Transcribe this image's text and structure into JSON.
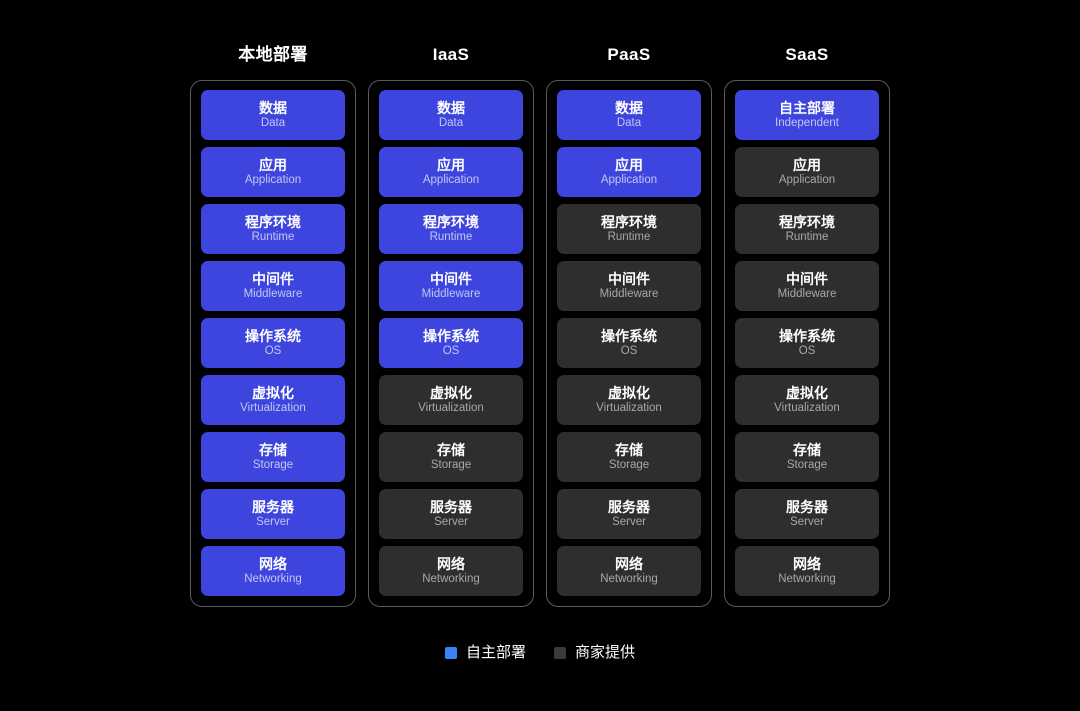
{
  "background_color": "#000000",
  "colors": {
    "self_deployed": "#3d45de",
    "vendor_provided": "#2e2e2e",
    "legend_self_deployed": "#3b82f6",
    "legend_vendor_provided": "#3a3a3a",
    "frame_border": "#5a5a5a",
    "title_text": "#ffffff",
    "en_on_blue": "#c3c7f2",
    "en_on_gray": "#a8a8a8"
  },
  "columns": [
    {
      "title": "本地部署",
      "layers": [
        {
          "zh": "数据",
          "en": "Data",
          "owner": "self"
        },
        {
          "zh": "应用",
          "en": "Application",
          "owner": "self"
        },
        {
          "zh": "程序环境",
          "en": "Runtime",
          "owner": "self"
        },
        {
          "zh": "中间件",
          "en": "Middleware",
          "owner": "self"
        },
        {
          "zh": "操作系统",
          "en": "OS",
          "owner": "self"
        },
        {
          "zh": "虚拟化",
          "en": "Virtualization",
          "owner": "self"
        },
        {
          "zh": "存储",
          "en": "Storage",
          "owner": "self"
        },
        {
          "zh": "服务器",
          "en": "Server",
          "owner": "self"
        },
        {
          "zh": "网络",
          "en": "Networking",
          "owner": "self"
        }
      ]
    },
    {
      "title": "IaaS",
      "layers": [
        {
          "zh": "数据",
          "en": "Data",
          "owner": "self"
        },
        {
          "zh": "应用",
          "en": "Application",
          "owner": "self"
        },
        {
          "zh": "程序环境",
          "en": "Runtime",
          "owner": "self"
        },
        {
          "zh": "中间件",
          "en": "Middleware",
          "owner": "self"
        },
        {
          "zh": "操作系统",
          "en": "OS",
          "owner": "self"
        },
        {
          "zh": "虚拟化",
          "en": "Virtualization",
          "owner": "vendor"
        },
        {
          "zh": "存储",
          "en": "Storage",
          "owner": "vendor"
        },
        {
          "zh": "服务器",
          "en": "Server",
          "owner": "vendor"
        },
        {
          "zh": "网络",
          "en": "Networking",
          "owner": "vendor"
        }
      ]
    },
    {
      "title": "PaaS",
      "layers": [
        {
          "zh": "数据",
          "en": "Data",
          "owner": "self"
        },
        {
          "zh": "应用",
          "en": "Application",
          "owner": "self"
        },
        {
          "zh": "程序环境",
          "en": "Runtime",
          "owner": "vendor"
        },
        {
          "zh": "中间件",
          "en": "Middleware",
          "owner": "vendor"
        },
        {
          "zh": "操作系统",
          "en": "OS",
          "owner": "vendor"
        },
        {
          "zh": "虚拟化",
          "en": "Virtualization",
          "owner": "vendor"
        },
        {
          "zh": "存储",
          "en": "Storage",
          "owner": "vendor"
        },
        {
          "zh": "服务器",
          "en": "Server",
          "owner": "vendor"
        },
        {
          "zh": "网络",
          "en": "Networking",
          "owner": "vendor"
        }
      ]
    },
    {
      "title": "SaaS",
      "layers": [
        {
          "zh": "自主部署",
          "en": "Independent",
          "owner": "self"
        },
        {
          "zh": "应用",
          "en": "Application",
          "owner": "vendor"
        },
        {
          "zh": "程序环境",
          "en": "Runtime",
          "owner": "vendor"
        },
        {
          "zh": "中间件",
          "en": "Middleware",
          "owner": "vendor"
        },
        {
          "zh": "操作系统",
          "en": "OS",
          "owner": "vendor"
        },
        {
          "zh": "虚拟化",
          "en": "Virtualization",
          "owner": "vendor"
        },
        {
          "zh": "存储",
          "en": "Storage",
          "owner": "vendor"
        },
        {
          "zh": "服务器",
          "en": "Server",
          "owner": "vendor"
        },
        {
          "zh": "网络",
          "en": "Networking",
          "owner": "vendor"
        }
      ]
    }
  ],
  "legend": {
    "items": [
      {
        "label": "自主部署",
        "color": "#3b82f6",
        "key": "self"
      },
      {
        "label": "商家提供",
        "color": "#3a3a3a",
        "key": "vendor"
      }
    ]
  }
}
